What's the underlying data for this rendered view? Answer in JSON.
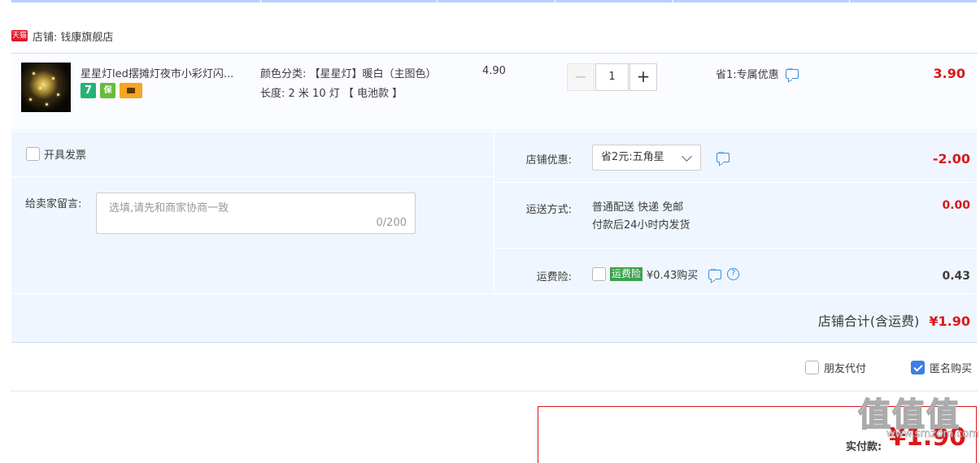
{
  "shop": {
    "badge": "天猫",
    "label": "店铺:",
    "name": "钱康旗舰店"
  },
  "item": {
    "title": "星星灯led摆摊灯夜市小彩灯闪...",
    "badges": [
      "7",
      "保",
      "card"
    ],
    "spec_color": "颜色分类: 【星星灯】暖白（主图色）",
    "spec_length": "长度: 2 米 10 灯 【 电池款 】",
    "price": "4.90",
    "quantity": "1",
    "promo": "省1:专属优惠",
    "subtotal": "3.90"
  },
  "options": {
    "invoice": "开具发票",
    "message_label": "给卖家留言:",
    "message_placeholder": "选填,请先和商家协商一致",
    "message_count": "0/200",
    "discount_label": "店铺优惠:",
    "discount_value": "省2元:五角星",
    "discount_amount": "-2.00",
    "shipping_label": "运送方式:",
    "shipping_method": "普通配送 快递 免邮",
    "shipping_note": "付款后24小时内发货",
    "shipping_amount": "0.00",
    "insurance_label": "运费险:",
    "insurance_tag": "运费险",
    "insurance_price": "¥0.43购买",
    "insurance_amount": "0.43",
    "total_label": "店铺合计(含运费)",
    "total_amount": "¥1.90"
  },
  "extras": {
    "friend_pay": "朋友代付",
    "anonymous": "匿名购买",
    "anonymous_checked": true
  },
  "pay": {
    "label": "实付款:",
    "amount": "¥1.90"
  },
  "watermark": {
    "logo": "值值值",
    "url": "www.smzdm.com"
  },
  "colors": {
    "price_red": "#d9181b",
    "accent_blue": "#3d7ee6",
    "insurance_green": "#3ba24c",
    "panel_bg": "#f0f6ff"
  }
}
